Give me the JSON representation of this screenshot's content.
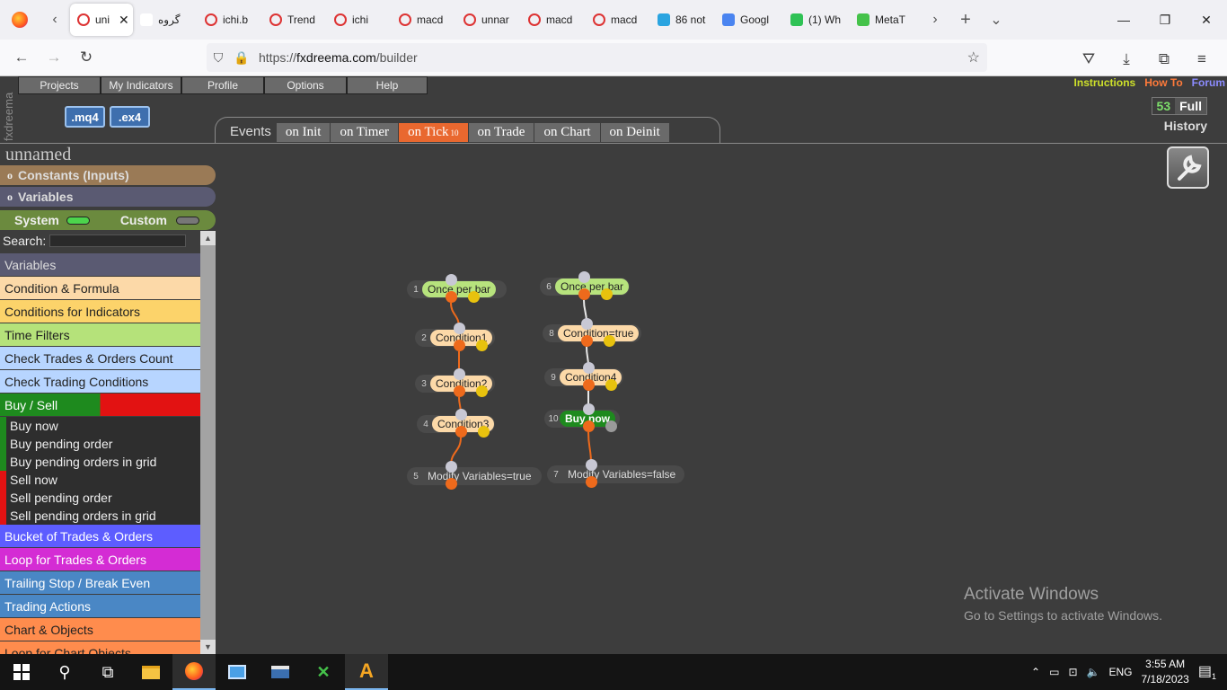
{
  "browser": {
    "tabs": [
      {
        "label": "uni",
        "icon": "fxdreema-icon",
        "active": true
      },
      {
        "label": "گروه",
        "icon": "google-icon"
      },
      {
        "label": "ichi.b",
        "icon": "fxdreema-icon"
      },
      {
        "label": "Trend",
        "icon": "fxdreema-icon"
      },
      {
        "label": "ichi",
        "icon": "fxdreema-icon"
      },
      {
        "label": "macd",
        "icon": "fxdreema-icon"
      },
      {
        "label": "unnar",
        "icon": "fxdreema-icon"
      },
      {
        "label": "macd",
        "icon": "fxdreema-icon"
      },
      {
        "label": "macd",
        "icon": "fxdreema-icon"
      },
      {
        "label": "86 not",
        "icon": "telegram-icon"
      },
      {
        "label": "Googl",
        "icon": "google-translate-icon"
      },
      {
        "label": "(1) Wh",
        "icon": "whatsapp-icon"
      },
      {
        "label": "MetaT",
        "icon": "metatrader-icon"
      }
    ],
    "url_prefix": "https://",
    "url_host": "fxdreema.com",
    "url_path": "/builder"
  },
  "app": {
    "logo": "fxdreema",
    "menu": [
      "Projects",
      "My Indicators",
      "Profile",
      "Options",
      "Help"
    ],
    "toplinks": [
      {
        "label": "Instructions",
        "color": "#cde02a"
      },
      {
        "label": "How To",
        "color": "#ff7a3a"
      },
      {
        "label": "Forum",
        "color": "#8c8cff"
      }
    ],
    "download": [
      ".mq4",
      ".ex4"
    ],
    "events_label": "Events",
    "events": [
      {
        "label": "on Init"
      },
      {
        "label": "on Timer"
      },
      {
        "label": "on Tick",
        "badge": "10",
        "active": true
      },
      {
        "label": "on Trade"
      },
      {
        "label": "on Chart"
      },
      {
        "label": "on Deinit"
      }
    ],
    "history": {
      "count": "53",
      "mode": "Full",
      "label": "History"
    },
    "project_name": "unnamed",
    "constants_label": "Constants (Inputs)",
    "variables_label": "Variables",
    "system_label": "System",
    "custom_label": "Custom",
    "search_label": "Search:",
    "categories": [
      {
        "label": "Variables",
        "bg": "#5a5a72",
        "color": "#ddd"
      },
      {
        "label": "Condition & Formula",
        "bg": "#fcd9a8",
        "color": "#222"
      },
      {
        "label": "Conditions for Indicators",
        "bg": "#fcd36a",
        "color": "#222"
      },
      {
        "label": "Time Filters",
        "bg": "#b5e27a",
        "color": "#222"
      },
      {
        "label": "Check Trades & Orders Count",
        "bg": "#b7d5ff",
        "color": "#222"
      },
      {
        "label": "Check Trading Conditions",
        "bg": "#b7d5ff",
        "color": "#222"
      },
      {
        "label": "Buy / Sell",
        "bg": "linear-gradient(90deg,#1e8a1e 50%,#e21212 50%)",
        "color": "#fff"
      }
    ],
    "buysell_items": [
      {
        "label": "Buy now",
        "side": "buy"
      },
      {
        "label": "Buy pending order",
        "side": "buy"
      },
      {
        "label": "Buy pending orders in grid",
        "side": "buy"
      },
      {
        "label": "Sell now",
        "side": "sell"
      },
      {
        "label": "Sell pending order",
        "side": "sell"
      },
      {
        "label": "Sell pending orders in grid",
        "side": "sell"
      }
    ],
    "categories_after": [
      {
        "label": "Bucket of Trades & Orders",
        "bg": "#5d5dff",
        "color": "#fff"
      },
      {
        "label": "Loop for Trades & Orders",
        "bg": "#d42cd4",
        "color": "#fff"
      },
      {
        "label": "Trailing Stop / Break Even",
        "bg": "#4a87c5",
        "color": "#fff"
      },
      {
        "label": "Trading Actions",
        "bg": "#4a87c5",
        "color": "#fff"
      },
      {
        "label": "Chart & Objects",
        "bg": "#ff8c4d",
        "color": "#222"
      },
      {
        "label": "Loop for Chart Objects",
        "bg": "#ff8c4d",
        "color": "#222"
      }
    ],
    "blocks": [
      {
        "num": "1",
        "label": "Once per bar",
        "color": "#b7e37d",
        "textcolor": "#222"
      },
      {
        "num": "2",
        "label": "Condition1",
        "color": "#fcd9a8",
        "textcolor": "#222"
      },
      {
        "num": "3",
        "label": "Condition2",
        "color": "#fcd9a8",
        "textcolor": "#222"
      },
      {
        "num": "4",
        "label": "Condition3",
        "color": "#fcd9a8",
        "textcolor": "#222"
      },
      {
        "num": "5",
        "label": "Modify Variables=true",
        "color": "#5a5a72",
        "textcolor": "#ddd"
      },
      {
        "num": "6",
        "label": "Once per bar",
        "color": "#b7e37d",
        "textcolor": "#222"
      },
      {
        "num": "8",
        "label": "Condition=true",
        "color": "#fcd9a8",
        "textcolor": "#222"
      },
      {
        "num": "9",
        "label": "Condition4",
        "color": "#fcd9a8",
        "textcolor": "#222"
      },
      {
        "num": "10",
        "label": "Buy now",
        "color": "#1e8a1e",
        "textcolor": "#fff"
      },
      {
        "num": "7",
        "label": "Modify Variables=false",
        "color": "#5a5a72",
        "textcolor": "#ddd"
      }
    ]
  },
  "watermark": {
    "title": "Activate Windows",
    "subtitle": "Go to Settings to activate Windows."
  },
  "taskbar": {
    "lang": "ENG",
    "time": "3:55 AM",
    "date": "7/18/2023",
    "notifications": "1"
  }
}
